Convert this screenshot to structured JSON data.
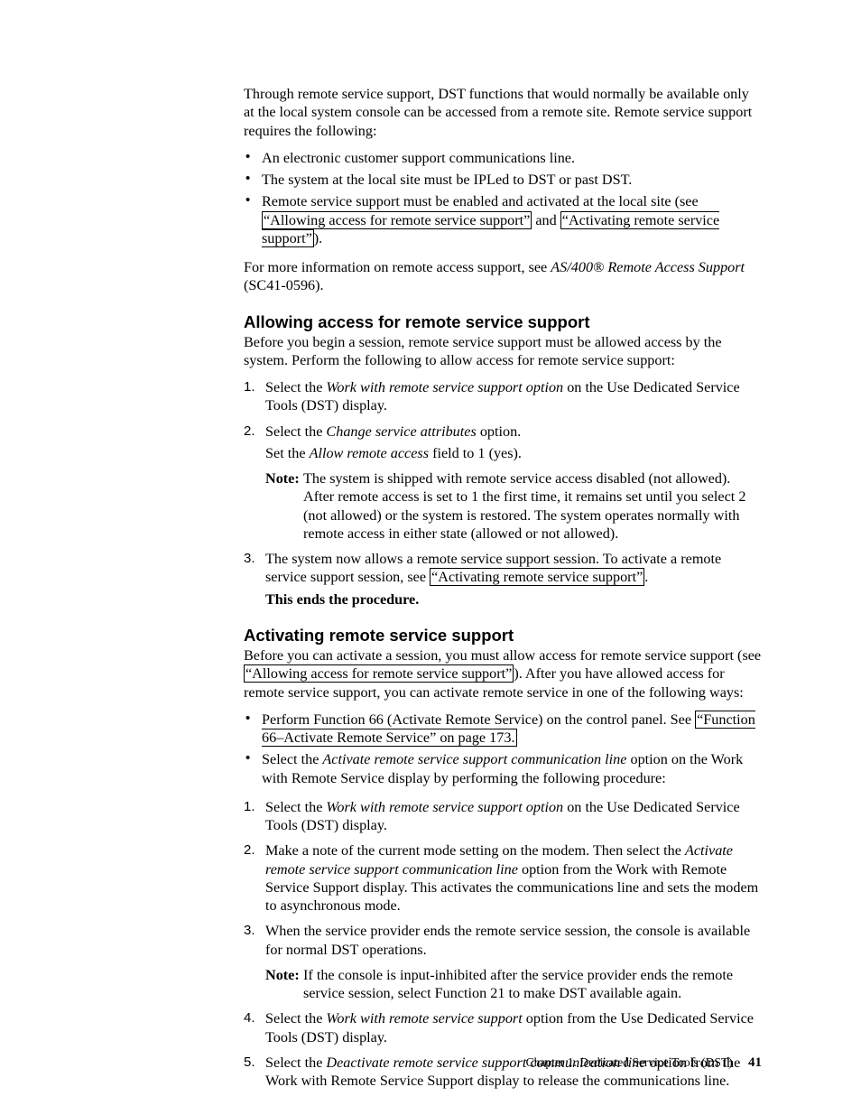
{
  "intro": {
    "p1": "Through remote service support, DST functions that would normally be available only at the local system console can be accessed from a remote site. Remote service support requires the following:",
    "bullets": {
      "b1": "An electronic customer support communications line.",
      "b2": "The system at the local site must be IPLed to DST or past DST.",
      "b3a": "Remote service support must be enabled and activated at the local site (see ",
      "b3link1": "“Allowing access for remote service support”",
      "b3b": " and ",
      "b3link2": "“Activating remote service support”",
      "b3c": ")."
    },
    "p2a": "For more information on remote access support, see ",
    "p2i": "AS/400® Remote Access Support",
    "p2b": " (SC41-0596)."
  },
  "sec1": {
    "heading": "Allowing access for remote service support",
    "p1": "Before you begin a session, remote service support must be allowed access by the system. Perform the following to allow access for remote service support:",
    "steps": {
      "s1m": "1.",
      "s1a": "Select the ",
      "s1i": "Work with remote service support option",
      "s1b": " on the Use Dedicated Service Tools (DST) display.",
      "s2m": "2.",
      "s2a": "Select the ",
      "s2i": "Change service attributes",
      "s2b": " option.",
      "s2suba": "Set the ",
      "s2subi": "Allow remote access",
      "s2subb": " field to 1 (yes).",
      "s2note_label": "Note:",
      "s2note": "The system is shipped with remote service access disabled (not allowed). After remote access is set to 1 the first time, it remains set until you select 2 (not allowed) or the system is restored. The system operates normally with remote access in either state (allowed or not allowed).",
      "s3m": "3.",
      "s3a": "The system now allows a remote service support session. To activate a remote service support session, see ",
      "s3link": "“Activating remote service support”",
      "s3b": ".",
      "s3end": "This ends the procedure."
    }
  },
  "sec2": {
    "heading": "Activating remote service support",
    "p1a": "Before you can activate a session, you must allow access for remote service support (see ",
    "p1link": "“Allowing access for remote service support”",
    "p1b": "). After you have allowed access for remote service support, you can activate remote service in one of the following ways:",
    "bullets": {
      "b1a": "Perform Function 66 (Activate Remote Service) on the control panel. See ",
      "b1link": "“Function 66–Activate Remote Service” on page 173.",
      "b2a": "Select the ",
      "b2i": "Activate remote service support communication line",
      "b2b": " option on the Work with Remote Service display by performing the following procedure:"
    },
    "steps": {
      "s1m": "1.",
      "s1a": "Select the ",
      "s1i": "Work with remote service support option",
      "s1b": " on the Use Dedicated Service Tools (DST) display.",
      "s2m": "2.",
      "s2a": "Make a note of the current mode setting on the modem. Then select the ",
      "s2i": "Activate remote service support communication line",
      "s2b": " option from the Work with Remote Service Support display. This activates the communications line and sets the modem to asynchronous mode.",
      "s3m": "3.",
      "s3": "When the service provider ends the remote service session, the console is available for normal DST operations.",
      "s3note_label": "Note:",
      "s3note": "If the console is input-inhibited after the service provider ends the remote service session, select Function 21 to make DST available again.",
      "s4m": "4.",
      "s4a": "Select the ",
      "s4i": "Work with remote service support",
      "s4b": " option from the Use Dedicated Service Tools (DST) display.",
      "s5m": "5.",
      "s5a": "Select the ",
      "s5i": "Deactivate remote service support communication line",
      "s5b": " option from the Work with Remote Service Support display to release the communications line."
    }
  },
  "footer": {
    "chapter": "Chapter 1. Dedicated Service Tools (DST)",
    "page": "41"
  }
}
